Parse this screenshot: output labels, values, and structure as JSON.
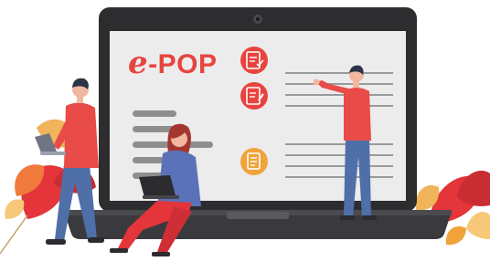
{
  "brand": {
    "logo_text": "e-POP",
    "logo_color": "#e8443f"
  },
  "icons": [
    "document-check-icon",
    "document-edit-icon",
    "document-list-icon"
  ],
  "colors": {
    "laptop_frame": "#2d2d30",
    "screen": "#ececec",
    "accent_red": "#e8443f",
    "accent_orange": "#f0a33a",
    "text_lines": "#8e8e8e",
    "person_shirt": "#e94b48",
    "person_pants": "#4f6fa8"
  }
}
